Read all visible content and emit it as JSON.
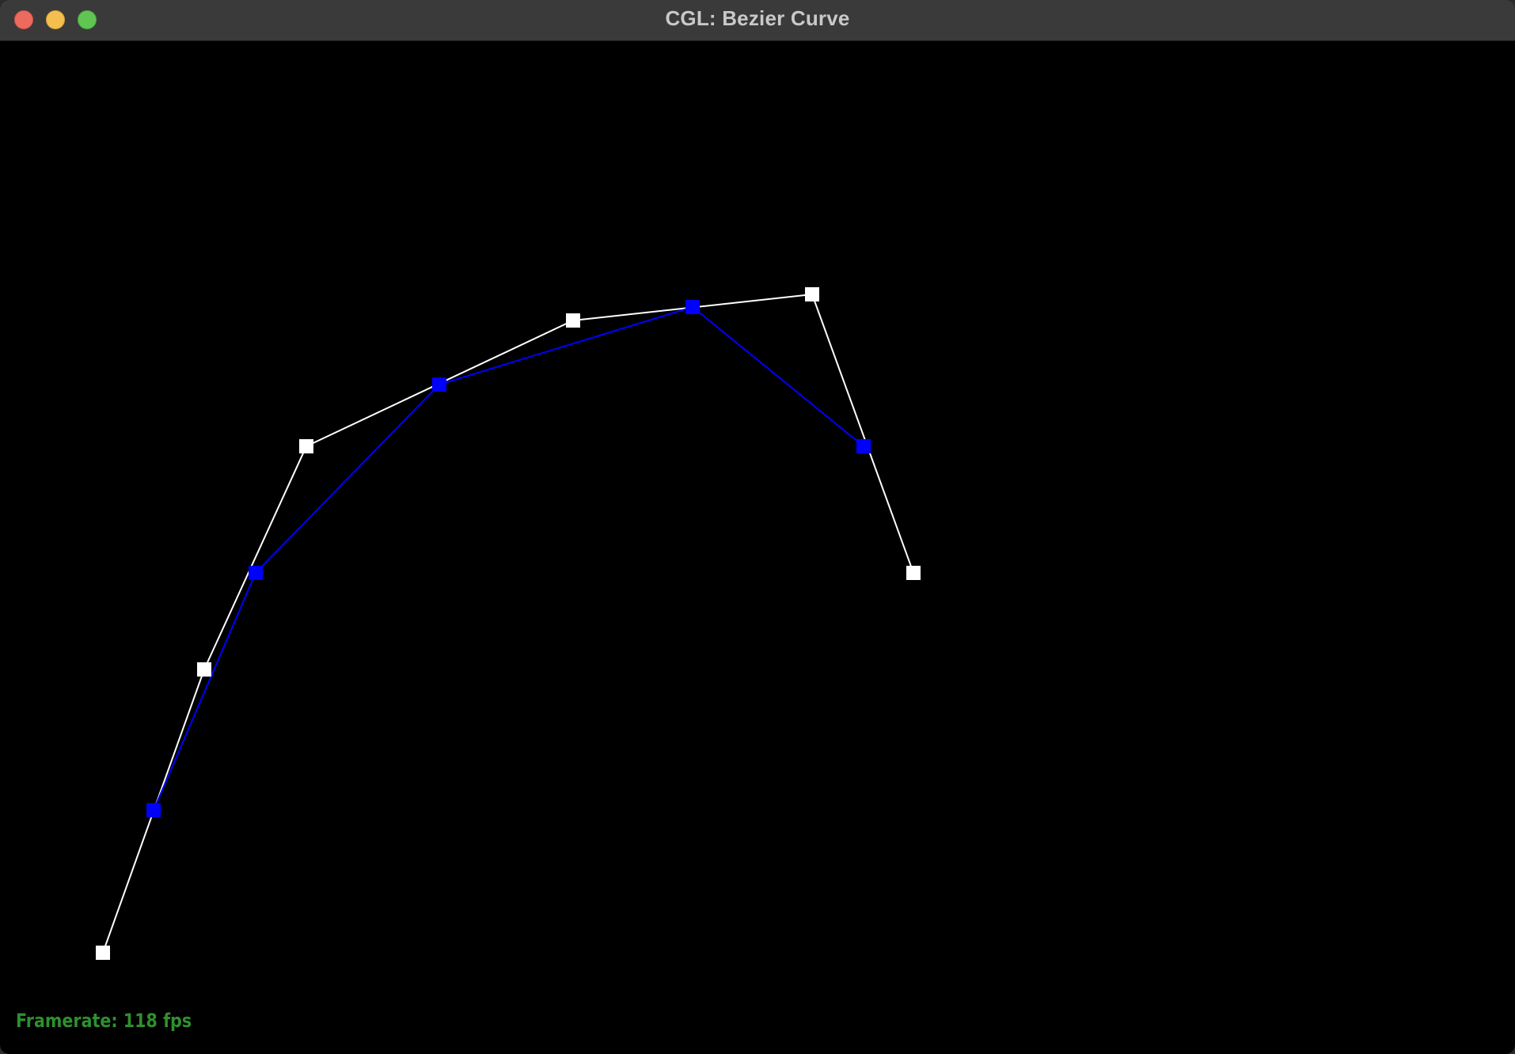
{
  "window": {
    "title": "CGL: Bezier Curve",
    "controls": [
      "close",
      "minimize",
      "zoom"
    ],
    "colors": {
      "close": "#ec6a5e",
      "minimize": "#f4bf4f",
      "zoom": "#61c554",
      "background": "#000000"
    }
  },
  "scene": {
    "control_polygon_color": "#ffffff",
    "subdivision_color": "#0000ff",
    "control_points": 6,
    "subdivision_points": 5
  },
  "status": {
    "framerate_text": "Framerate: 118 fps",
    "framerate_color": "#2f8f2f"
  }
}
